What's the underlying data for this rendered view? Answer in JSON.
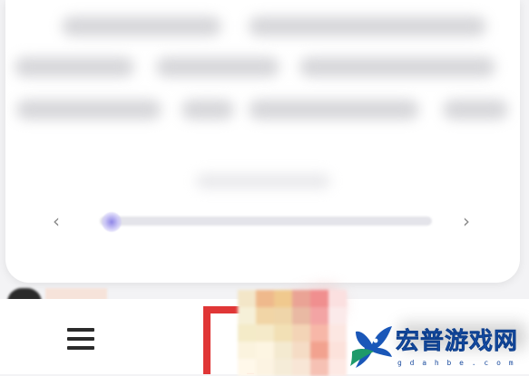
{
  "carousel": {
    "prev_glyph": "‹",
    "next_glyph": "›",
    "progress_fraction": 0.03
  },
  "bottom_nav": {
    "menu_icon": "hamburger-menu-icon"
  },
  "watermark": {
    "logo_icon": "bird-logo-icon",
    "title": "宏普游戏网",
    "subtitle": "g d a h b e . c o m"
  },
  "colors": {
    "slider_thumb": "#8f86e6",
    "highlight_box": "#e03636",
    "watermark_blue": "#1a57b8"
  }
}
